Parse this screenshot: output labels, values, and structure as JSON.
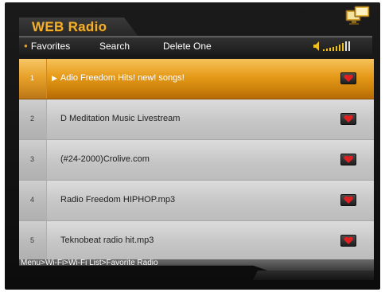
{
  "app": {
    "title": "WEB Radio"
  },
  "menu": {
    "items": [
      {
        "label": "Favorites",
        "active": true
      },
      {
        "label": "Search",
        "active": false
      },
      {
        "label": "Delete One",
        "active": false
      }
    ]
  },
  "icons": {
    "top_right": "monitor-network-icon",
    "volume": "volume-icon",
    "favorite": "heart-icon"
  },
  "colors": {
    "accent": "#f0a020",
    "selected_row": "#e69a18",
    "favorite_heart": "#e02020"
  },
  "volume_level": 0.8,
  "stations": [
    {
      "num": "1",
      "name": "Adio Freedom Hits! new! songs!",
      "selected": true
    },
    {
      "num": "2",
      "name": "D Meditation Music Livestream",
      "selected": false
    },
    {
      "num": "3",
      "name": "(#24-2000)Crolive.com",
      "selected": false
    },
    {
      "num": "4",
      "name": "Radio Freedom HIPHOP.mp3",
      "selected": false
    },
    {
      "num": "5",
      "name": "Teknobeat radio hit.mp3",
      "selected": false
    }
  ],
  "status": {
    "breadcrumb": "Menu>Wi-Fi>Wi-Fi List>Favorite Radio"
  }
}
